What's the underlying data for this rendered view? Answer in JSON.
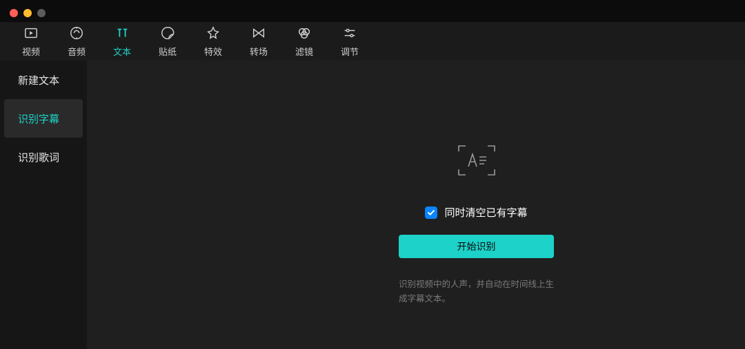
{
  "toolbar": {
    "items": [
      {
        "label": "视频",
        "icon": "video-icon"
      },
      {
        "label": "音频",
        "icon": "audio-icon"
      },
      {
        "label": "文本",
        "icon": "text-icon",
        "active": true
      },
      {
        "label": "贴纸",
        "icon": "sticker-icon"
      },
      {
        "label": "特效",
        "icon": "effects-icon"
      },
      {
        "label": "转场",
        "icon": "transition-icon"
      },
      {
        "label": "滤镜",
        "icon": "filter-icon"
      },
      {
        "label": "调节",
        "icon": "adjust-icon"
      }
    ]
  },
  "sidebar": {
    "items": [
      {
        "label": "新建文本"
      },
      {
        "label": "识别字幕",
        "selected": true
      },
      {
        "label": "识别歌词"
      }
    ]
  },
  "main": {
    "checkbox_label": "同时清空已有字幕",
    "checkbox_checked": true,
    "action_label": "开始识别",
    "description": "识别视频中的人声，并自动在时间线上生成字幕文本。"
  },
  "colors": {
    "accent": "#1dd2c8",
    "checkbox_bg": "#0a84ff"
  }
}
